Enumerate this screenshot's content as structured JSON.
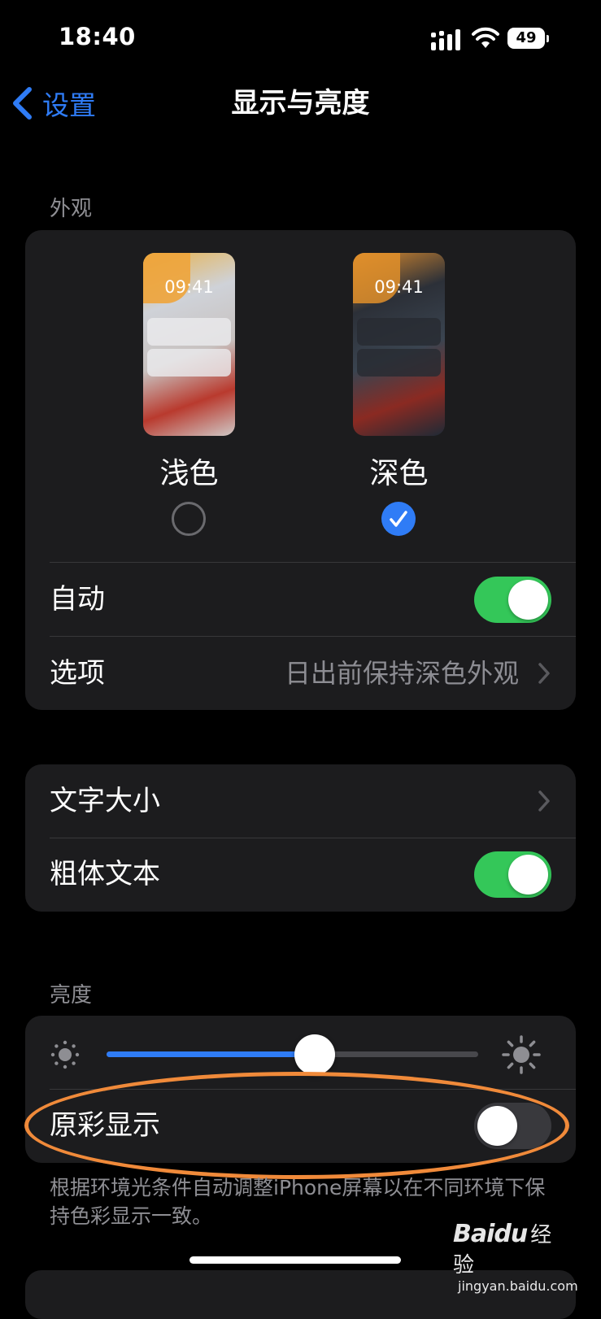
{
  "status_bar": {
    "time": "18:40",
    "battery": "49"
  },
  "nav": {
    "back_label": "设置",
    "title": "显示与亮度"
  },
  "appearance": {
    "header": "外观",
    "light": {
      "label": "浅色",
      "time": "09:41",
      "selected": false
    },
    "dark": {
      "label": "深色",
      "time": "09:41",
      "selected": true
    },
    "auto": {
      "label": "自动",
      "on": true
    },
    "options": {
      "label": "选项",
      "value": "日出前保持深色外观"
    }
  },
  "text": {
    "text_size": {
      "label": "文字大小"
    },
    "bold_text": {
      "label": "粗体文本",
      "on": true
    }
  },
  "brightness": {
    "header": "亮度",
    "level": 0.56,
    "true_tone": {
      "label": "原彩显示",
      "on": false
    },
    "footnote": "根据环境光条件自动调整iPhone屏幕以在不同环境下保持色彩显示一致。"
  },
  "watermark": {
    "logo": "Bai",
    "logo2": "du",
    "logo_cn": "经验",
    "sub": "jingyan.baidu.com"
  },
  "colors": {
    "accent": "#2f7cf6",
    "toggle_on": "#34c759",
    "highlight": "#f08a3a"
  }
}
